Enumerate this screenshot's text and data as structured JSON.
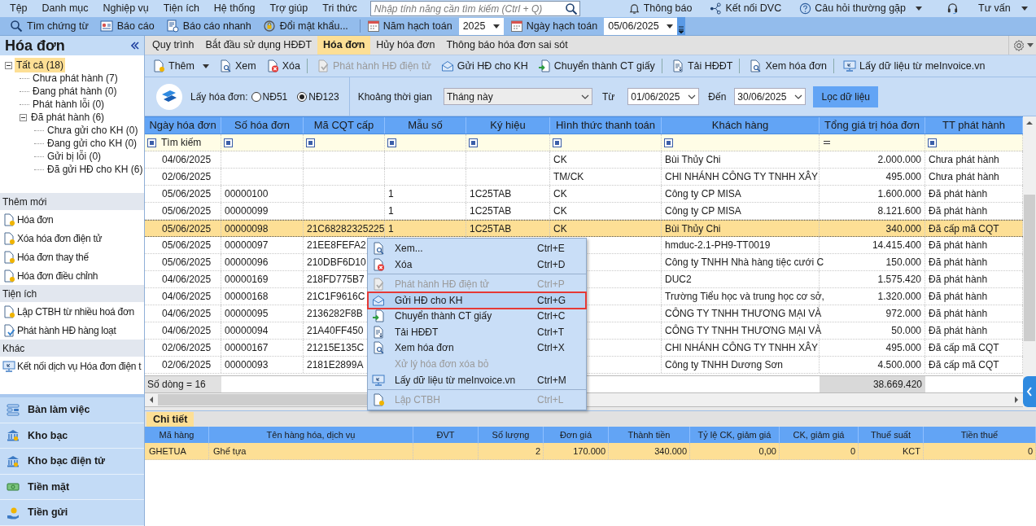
{
  "menu_bar": {
    "items": [
      "Tệp",
      "Danh mục",
      "Nghiệp vụ",
      "Tiện ích",
      "Hệ thống",
      "Trợ giúp",
      "Tri thức"
    ],
    "search": {
      "placeholder": "Nhập tính năng cần tìm kiếm (Ctrl + Q)"
    },
    "right_items": [
      {
        "label": "Thông báo",
        "kind": "bell",
        "dropdown": false
      },
      {
        "label": "Kết nối DVC",
        "kind": "network",
        "dropdown": false
      },
      {
        "label": "Câu hỏi thường gặp",
        "kind": "help",
        "dropdown": true
      },
      {
        "label": "Tư vấn",
        "kind": "headset",
        "dropdown": true
      }
    ]
  },
  "toolbar": {
    "buttons": [
      {
        "label": "Tìm chứng từ",
        "kind": "search"
      },
      {
        "label": "Báo cáo",
        "kind": "report"
      },
      {
        "label": "Báo cáo nhanh",
        "kind": "quick"
      },
      {
        "label": "Đổi mật khẩu...",
        "kind": "lock"
      }
    ],
    "fiscal_year": {
      "label": "Năm hạch toán",
      "value": "2025"
    },
    "posting_date": {
      "label": "Ngày hạch toán",
      "value": "05/06/2025"
    }
  },
  "sidebar": {
    "title": "Hóa đơn",
    "tree": [
      {
        "label": "Tất cả (18)",
        "selected": true,
        "expanded": true,
        "children": [
          {
            "label": "Chưa phát hành (7)",
            "selected": false
          },
          {
            "label": "Đang phát hành (0)",
            "selected": false
          },
          {
            "label": "Phát hành lỗi (0)",
            "selected": false
          },
          {
            "label": "Đã phát hành (6)",
            "selected": false,
            "expanded": true,
            "children": [
              {
                "label": "Chưa gửi cho KH (0)",
                "selected": false
              },
              {
                "label": "Đang gửi cho KH (0)",
                "selected": false
              },
              {
                "label": "Gửi bị lỗi (0)",
                "selected": false
              },
              {
                "label": "Đã gửi HĐ cho KH (6)",
                "selected": false
              }
            ]
          }
        ]
      }
    ],
    "sections": [
      {
        "title": "Thêm mới",
        "items": [
          {
            "label": "Hóa đơn",
            "kind": "doc-add"
          },
          {
            "label": "Xóa hóa đơn điện tử",
            "kind": "doc-add"
          },
          {
            "label": "Hóa đơn thay thế",
            "kind": "doc-add"
          },
          {
            "label": "Hóa đơn điều chỉnh",
            "kind": "doc-add"
          }
        ]
      },
      {
        "title": "Tiện ích",
        "items": [
          {
            "label": "Lập CTBH từ nhiều hoá đơn",
            "kind": "doc-add"
          },
          {
            "label": "Phát hành HĐ hàng loạt",
            "kind": "doc-check"
          }
        ]
      },
      {
        "title": "Khác",
        "items": [
          {
            "label": "Kết nối dịch vụ Hóa đơn điện t",
            "kind": "monitor"
          }
        ]
      }
    ],
    "nav": [
      {
        "label": "Bàn làm việc",
        "kind": "desk"
      },
      {
        "label": "Kho bạc",
        "kind": "bank"
      },
      {
        "label": "Kho bạc điện tử",
        "kind": "bank"
      },
      {
        "label": "Tiền mặt",
        "kind": "cash"
      },
      {
        "label": "Tiền gửi",
        "kind": "deposit"
      }
    ]
  },
  "tabs": [
    {
      "label": "Quy trình",
      "selected": false
    },
    {
      "label": "Bắt đầu sử dụng HĐĐT",
      "selected": false
    },
    {
      "label": "Hóa đơn",
      "selected": true
    },
    {
      "label": "Hủy hóa đơn",
      "selected": false
    },
    {
      "label": "Thông báo hóa đơn sai sót",
      "selected": false
    }
  ],
  "actions": [
    {
      "label": "Thêm",
      "kind": "doc-add",
      "disabled": false,
      "dropdown": true,
      "divider_after": false
    },
    {
      "label": "Xem",
      "kind": "doc-view",
      "disabled": false,
      "dropdown": false,
      "divider_after": false
    },
    {
      "label": "Xóa",
      "kind": "doc-delete",
      "disabled": false,
      "dropdown": false,
      "divider_after": true
    },
    {
      "label": "Phát hành HĐ điện tử",
      "kind": "doc-issue",
      "disabled": true,
      "dropdown": false,
      "divider_after": false
    },
    {
      "label": "Gửi HĐ cho KH",
      "kind": "envelope",
      "disabled": false,
      "dropdown": false,
      "divider_after": false
    },
    {
      "label": "Chuyển thành CT giấy",
      "kind": "doc-convert",
      "disabled": false,
      "dropdown": false,
      "divider_after": true
    },
    {
      "label": "Tải HĐĐT",
      "kind": "doc-download",
      "disabled": false,
      "dropdown": false,
      "divider_after": true
    },
    {
      "label": "Xem hóa đơn",
      "kind": "doc-view",
      "disabled": false,
      "dropdown": false,
      "divider_after": true
    },
    {
      "label": "Lấy dữ liệu từ meInvoice.vn",
      "kind": "monitor",
      "disabled": false,
      "dropdown": false,
      "divider_after": false
    }
  ],
  "filter": {
    "source_label": "Lấy hóa đơn:",
    "options": [
      {
        "label": "NĐ51",
        "selected": false
      },
      {
        "label": "NĐ123",
        "selected": true
      }
    ],
    "period_label": "Khoảng thời gian",
    "period": "Tháng này",
    "from_label": "Từ",
    "from": "01/06/2025",
    "to_label": "Đến",
    "to": "30/06/2025",
    "button": "Lọc dữ liệu"
  },
  "grid": {
    "columns": [
      {
        "label": "Ngày hóa đơn",
        "kind": "text"
      },
      {
        "label": "Số hóa đơn",
        "kind": "text"
      },
      {
        "label": "Mã CQT cấp",
        "kind": "text"
      },
      {
        "label": "Mẫu số",
        "kind": "text"
      },
      {
        "label": "Ký hiệu",
        "kind": "text"
      },
      {
        "label": "Hình thức thanh toán",
        "kind": "text"
      },
      {
        "label": "Khách hàng",
        "kind": "text"
      },
      {
        "label": "Tổng giá trị hóa đơn",
        "kind": "number"
      },
      {
        "label": "TT phát hành",
        "kind": "text"
      }
    ],
    "search_prompt": "Tìm kiếm",
    "rows": [
      {
        "selected": false,
        "cells": [
          "04/06/2025",
          "",
          "",
          "",
          "",
          "CK",
          "Bùi Thủy Chi",
          "2.000.000",
          "Chưa phát hành"
        ]
      },
      {
        "selected": false,
        "cells": [
          "02/06/2025",
          "",
          "",
          "",
          "",
          "TM/CK",
          "CHI NHÁNH CÔNG TY TNHH XÂY",
          "495.000",
          "Chưa phát hành"
        ]
      },
      {
        "selected": false,
        "cells": [
          "05/06/2025",
          "00000100",
          "",
          "1",
          "1C25TAB",
          "CK",
          "Công ty CP MISA",
          "1.600.000",
          "Đã phát hành"
        ]
      },
      {
        "selected": false,
        "cells": [
          "05/06/2025",
          "00000099",
          "",
          "1",
          "1C25TAB",
          "CK",
          "Công ty CP MISA",
          "8.121.600",
          "Đã phát hành"
        ]
      },
      {
        "selected": true,
        "cells": [
          "05/06/2025",
          "00000098",
          "21C68282325225",
          "1",
          "1C25TAB",
          "CK",
          "Bùi Thủy Chi",
          "340.000",
          "Đã cấp mã CQT"
        ]
      },
      {
        "selected": false,
        "cells": [
          "05/06/2025",
          "00000097",
          "21EE8FEFA2",
          "",
          "",
          "",
          "hmduc-2.1-PH9-TT0019",
          "14.415.400",
          "Đã phát hành"
        ]
      },
      {
        "selected": false,
        "cells": [
          "05/06/2025",
          "00000096",
          "210DBF6D10",
          "",
          "",
          "",
          "Công ty TNHH Nhà hàng tiệc cưới C",
          "150.000",
          "Đã phát hành"
        ]
      },
      {
        "selected": false,
        "cells": [
          "04/06/2025",
          "00000169",
          "218FD775B7",
          "",
          "",
          "",
          "DUC2",
          "1.575.420",
          "Đã phát hành"
        ]
      },
      {
        "selected": false,
        "cells": [
          "04/06/2025",
          "00000168",
          "21C1F9616C",
          "",
          "",
          "",
          "Trường Tiểu học và trung học cơ sở,",
          "1.320.000",
          "Đã phát hành"
        ]
      },
      {
        "selected": false,
        "cells": [
          "04/06/2025",
          "00000095",
          "2136282F8B",
          "",
          "",
          "",
          "CÔNG TY TNHH THƯƠNG MẠI VÀ",
          "972.000",
          "Đã phát hành"
        ]
      },
      {
        "selected": false,
        "cells": [
          "04/06/2025",
          "00000094",
          "21A40FF450",
          "",
          "",
          "",
          "CÔNG TY TNHH THƯƠNG MẠI VÀ",
          "50.000",
          "Đã phát hành"
        ]
      },
      {
        "selected": false,
        "cells": [
          "02/06/2025",
          "00000167",
          "21215E135C",
          "",
          "",
          "",
          "CHI NHÁNH CÔNG TY TNHH XÂY",
          "495.000",
          "Đã cấp mã CQT"
        ]
      },
      {
        "selected": false,
        "cells": [
          "02/06/2025",
          "00000093",
          "2181E2899A",
          "",
          "",
          "",
          "Công ty TNHH Dương Sơn",
          "4.500.000",
          "Đã cấp mã CQT"
        ]
      }
    ],
    "footer": {
      "count": "Số dòng = 16",
      "total": "38.669.420"
    }
  },
  "context_menu": {
    "items": [
      {
        "label": "Xem...",
        "shortcut": "Ctrl+E",
        "kind": "doc-view",
        "disabled": false,
        "highlighted": false,
        "divider_after": false
      },
      {
        "label": "Xóa",
        "shortcut": "Ctrl+D",
        "kind": "doc-delete",
        "disabled": false,
        "highlighted": false,
        "divider_after": true
      },
      {
        "label": "Phát hành HĐ điện tử",
        "shortcut": "Ctrl+P",
        "kind": "doc-issue",
        "disabled": true,
        "highlighted": false,
        "divider_after": false
      },
      {
        "label": "Gửi HĐ cho KH",
        "shortcut": "Ctrl+G",
        "kind": "envelope",
        "disabled": false,
        "highlighted": true,
        "divider_after": false
      },
      {
        "label": "Chuyển thành CT giấy",
        "shortcut": "Ctrl+C",
        "kind": "doc-convert",
        "disabled": false,
        "highlighted": false,
        "divider_after": false
      },
      {
        "label": "Tải HĐĐT",
        "shortcut": "Ctrl+T",
        "kind": "doc-download",
        "disabled": false,
        "highlighted": false,
        "divider_after": false
      },
      {
        "label": "Xem hóa đơn",
        "shortcut": "Ctrl+X",
        "kind": "doc-view",
        "disabled": false,
        "highlighted": false,
        "divider_after": false
      },
      {
        "label": "Xử lý hóa đơn xóa bỏ",
        "kind": "none",
        "disabled": true,
        "highlighted": false,
        "divider_after": false
      },
      {
        "label": "Lấy dữ liệu từ meInvoice.vn",
        "shortcut": "Ctrl+M",
        "kind": "monitor",
        "disabled": false,
        "highlighted": false,
        "divider_after": true
      },
      {
        "label": "Lập CTBH",
        "shortcut": "Ctrl+L",
        "kind": "doc-add",
        "disabled": true,
        "highlighted": false,
        "divider_after": false
      }
    ]
  },
  "detail": {
    "tab": "Chi tiết",
    "columns": [
      {
        "label": "Mã hàng",
        "kind": "text"
      },
      {
        "label": "Tên hàng hóa, dịch vụ",
        "kind": "text"
      },
      {
        "label": "ĐVT",
        "kind": "text"
      },
      {
        "label": "Số lượng",
        "kind": "number"
      },
      {
        "label": "Đơn giá",
        "kind": "number"
      },
      {
        "label": "Thành tiền",
        "kind": "number"
      },
      {
        "label": "Tỷ lệ CK, giảm giá",
        "kind": "number"
      },
      {
        "label": "CK, giảm giá",
        "kind": "number"
      },
      {
        "label": "Thuế suất",
        "kind": "number"
      },
      {
        "label": "Tiền thuế",
        "kind": "number"
      }
    ],
    "rows": [
      {
        "selected": true,
        "cells": [
          "GHETUA",
          "Ghế tựa",
          "",
          "2",
          "170.000",
          "340.000",
          "0,00",
          "0",
          "KCT",
          "0"
        ]
      }
    ]
  }
}
